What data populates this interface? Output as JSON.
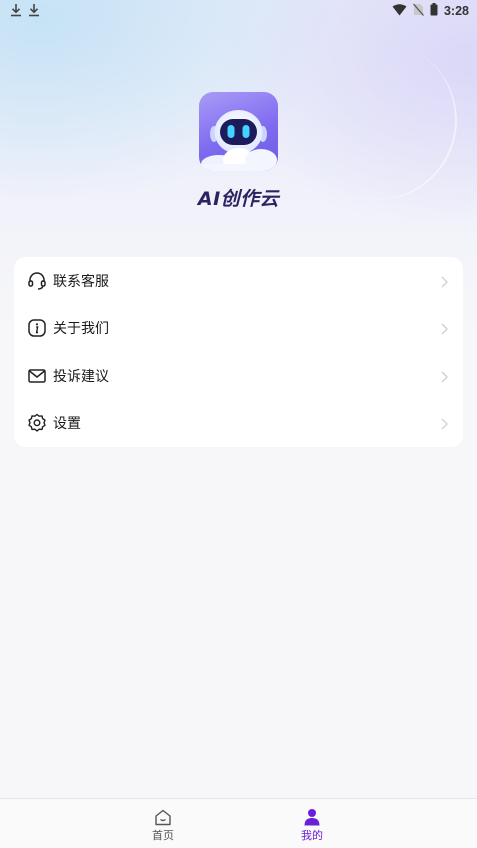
{
  "status_bar": {
    "left_icons": [
      "download-icon",
      "download-icon"
    ],
    "right_icons": [
      "wifi-icon",
      "no-sim-icon",
      "battery-icon"
    ],
    "time": "3:28"
  },
  "app": {
    "name": "AI创作云",
    "logo_icon": "robot-logo-icon"
  },
  "menu": {
    "items": [
      {
        "label": "联系客服",
        "icon": "headset-icon"
      },
      {
        "label": "关于我们",
        "icon": "info-icon"
      },
      {
        "label": "投诉建议",
        "icon": "mail-icon"
      },
      {
        "label": "设置",
        "icon": "gear-icon"
      }
    ]
  },
  "tabbar": {
    "tabs": [
      {
        "label": "首页",
        "icon": "home-icon",
        "active": false
      },
      {
        "label": "我的",
        "icon": "person-icon",
        "active": true
      }
    ]
  },
  "colors": {
    "accent": "#6a1fd8",
    "inactive": "#555555",
    "logo_gradient_start": "#a99bf6",
    "logo_gradient_end": "#6e5ae6"
  }
}
